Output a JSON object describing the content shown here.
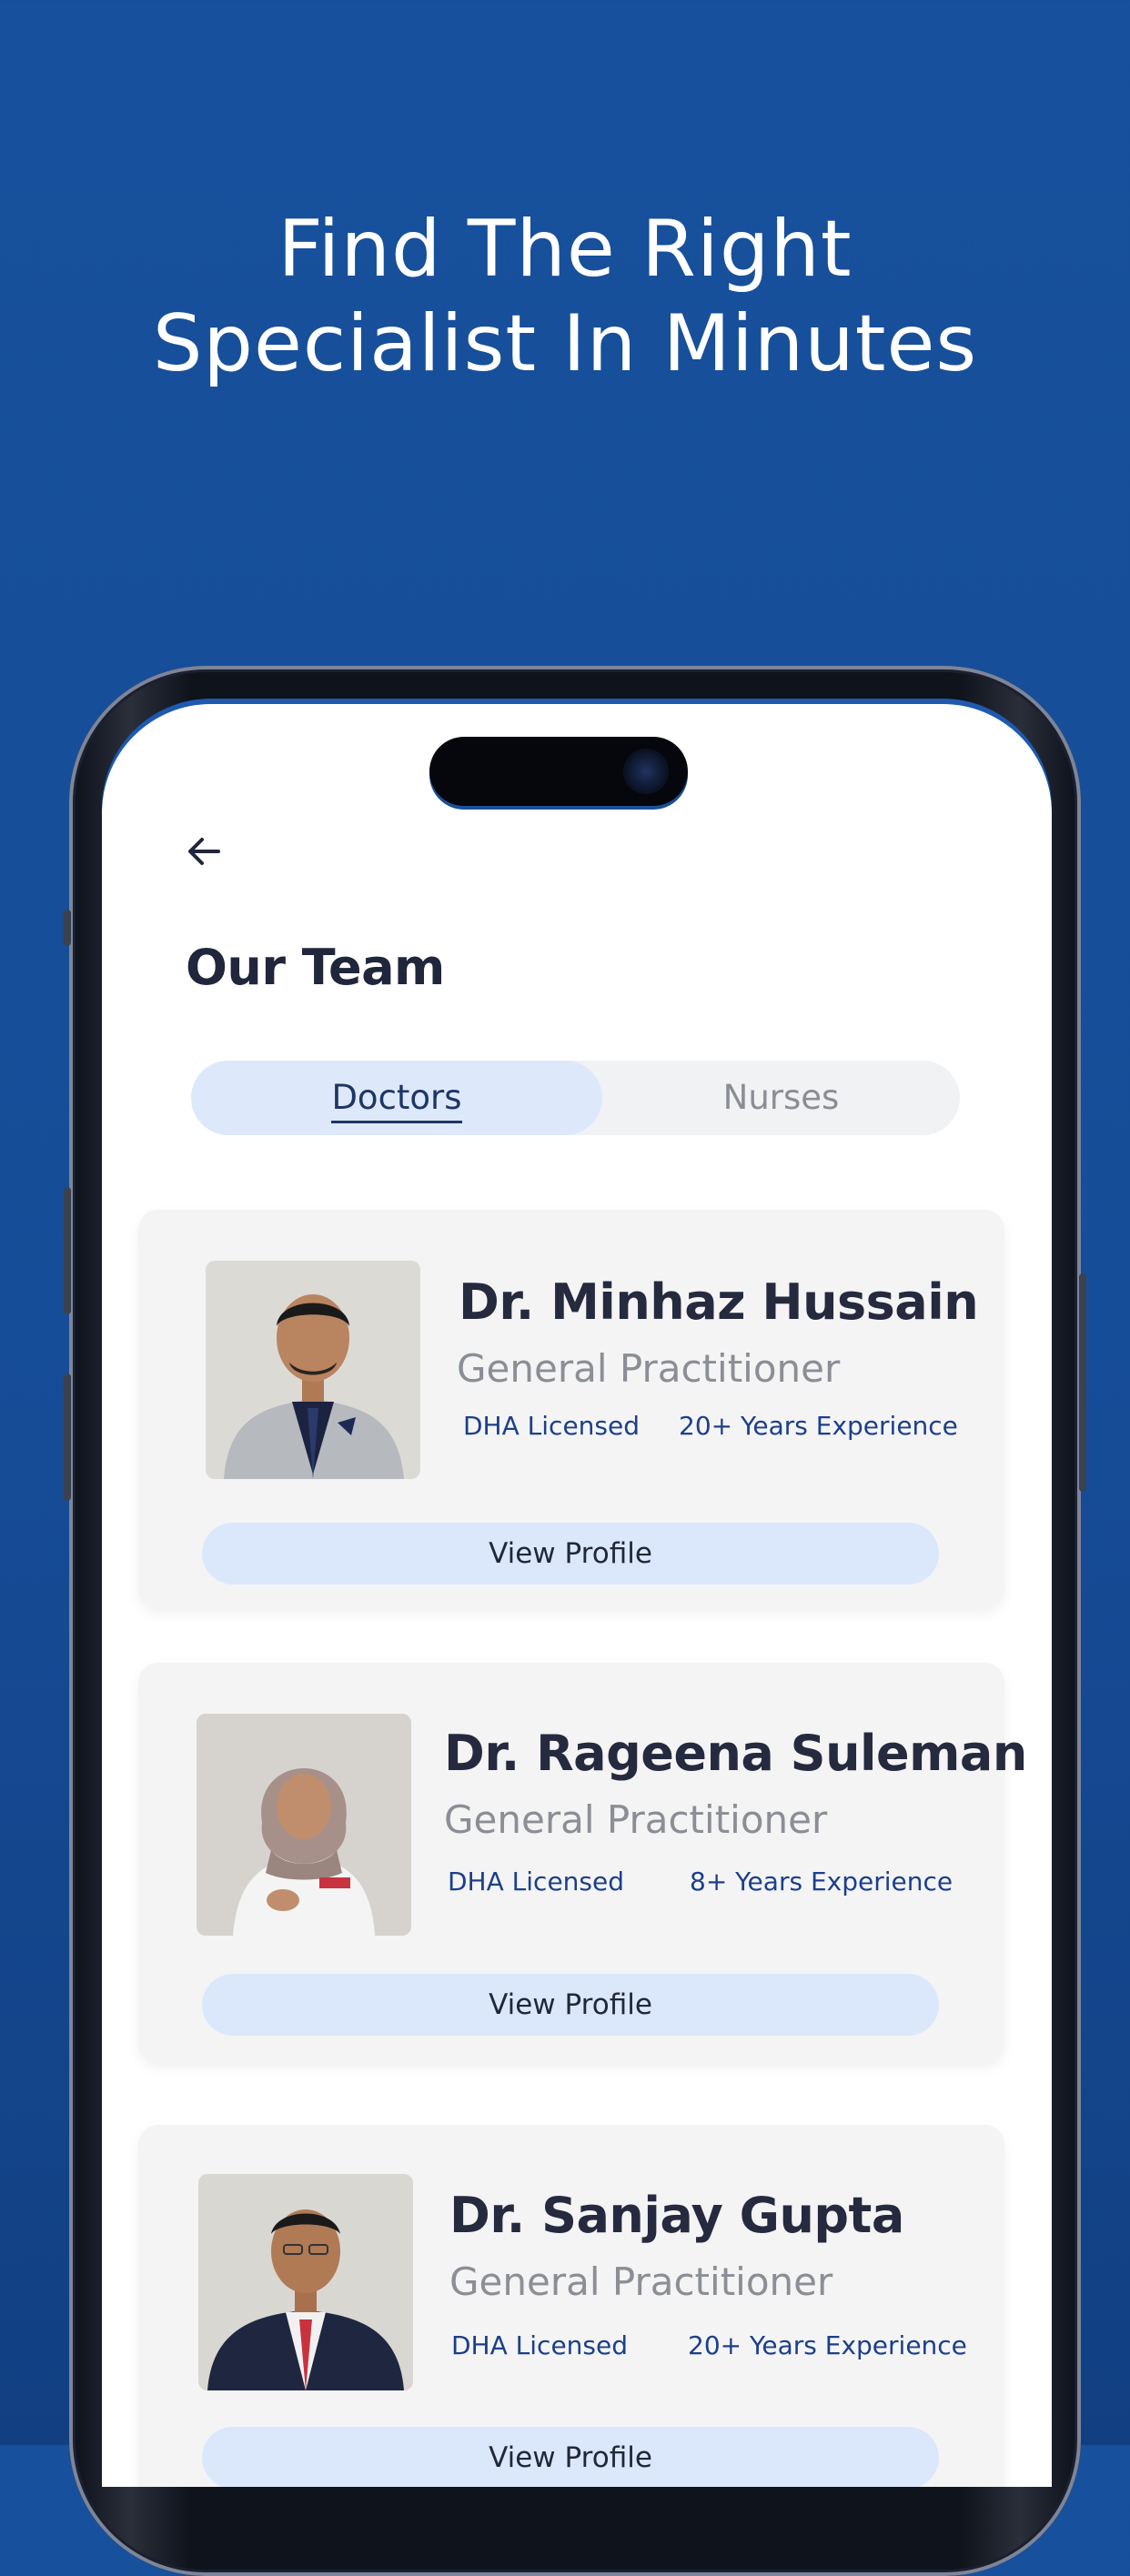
{
  "headline": {
    "line1": "Find The Right",
    "line2": "Specialist In Minutes"
  },
  "screen": {
    "back_icon": "arrow-left-icon",
    "title": "Our Team",
    "tabs": [
      {
        "label": "Doctors",
        "active": true
      },
      {
        "label": "Nurses",
        "active": false
      }
    ],
    "doctors": [
      {
        "name": "Dr. Minhaz Hussain",
        "role": "General Practitioner",
        "license": "DHA Licensed",
        "experience": "20+ Years Experience",
        "button": "View Profile"
      },
      {
        "name": "Dr. Rageena Suleman",
        "role": "General Practitioner",
        "license": "DHA Licensed",
        "experience": "8+ Years Experience",
        "button": "View Profile"
      },
      {
        "name": "Dr. Sanjay Gupta",
        "role": "General Practitioner",
        "license": "DHA Licensed",
        "experience": "20+ Years Experience",
        "button": "View Profile"
      }
    ]
  },
  "colors": {
    "background": "#17509c",
    "accent_tab": "#dde9fb",
    "text_dark": "#20263b",
    "meta_blue": "#1c3f8a"
  }
}
